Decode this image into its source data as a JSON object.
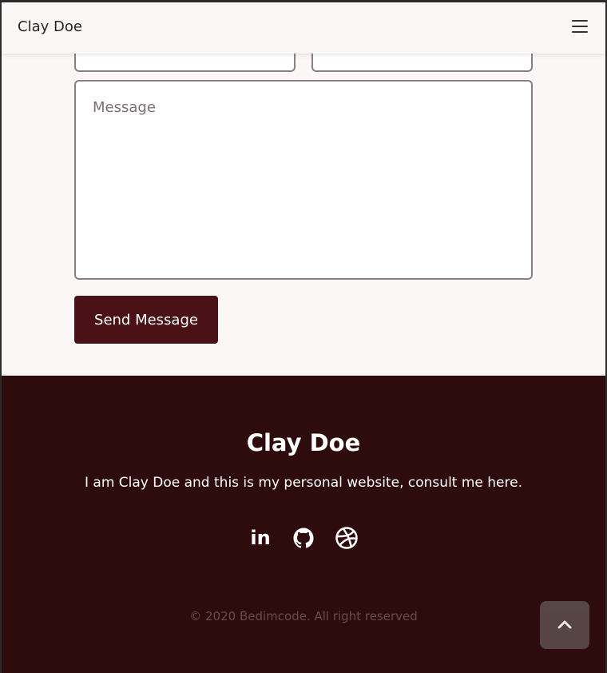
{
  "header": {
    "logo": "Clay Doe",
    "menu_icon": "menu-icon"
  },
  "contact_form": {
    "message_placeholder": "Message",
    "send_label": "Send Message"
  },
  "footer": {
    "title": "Clay Doe",
    "description": "I am Clay Doe and this is my personal website, consult me here.",
    "social": [
      {
        "icon": "linkedin-icon",
        "label": "in"
      },
      {
        "icon": "github-icon"
      },
      {
        "icon": "dribbble-icon"
      }
    ],
    "copyright": "© 2020 Bedimcode. All right reserved"
  },
  "scroll_up": {
    "icon": "chevron-up-icon"
  },
  "colors": {
    "primary": "#4a1217",
    "footer_bg": "#2e0c0e",
    "page_bg": "#fbf7f7",
    "scroll_btn": "#5c4c4d"
  }
}
